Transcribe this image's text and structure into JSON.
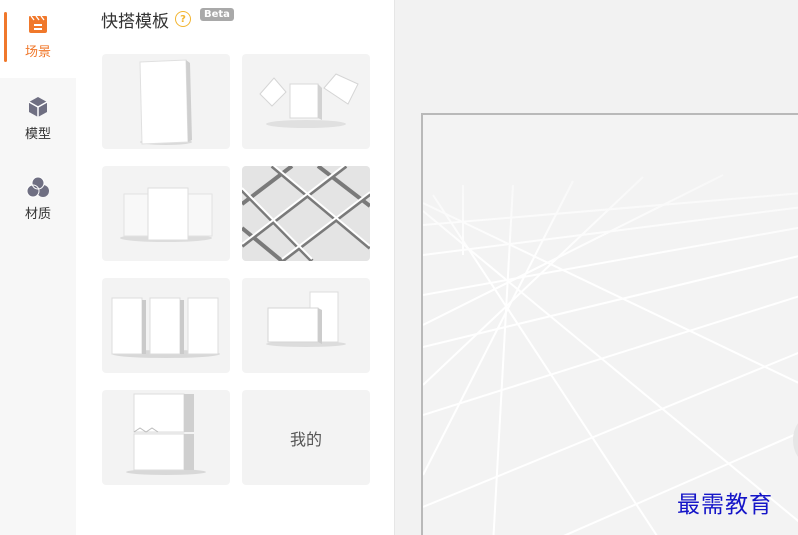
{
  "rail": {
    "items": [
      {
        "label": "场景",
        "icon": "scene-icon",
        "active": true
      },
      {
        "label": "模型",
        "icon": "cube-icon",
        "active": false
      },
      {
        "label": "材质",
        "icon": "material-icon",
        "active": false
      }
    ]
  },
  "panel": {
    "title": "快搭模板",
    "help_icon_text": "?",
    "badge": "Beta",
    "cards": [
      {
        "name": "template-single-board"
      },
      {
        "name": "template-floating-cubes"
      },
      {
        "name": "template-triple-panels"
      },
      {
        "name": "template-grid-floor"
      },
      {
        "name": "template-three-pillars"
      },
      {
        "name": "template-stacked-boxes"
      },
      {
        "name": "template-split-pillar"
      },
      {
        "name": "template-mine",
        "label": "我的"
      }
    ]
  },
  "watermark": "最需教育",
  "colors": {
    "accent": "#f0782b",
    "help": "#f2b531",
    "badge": "#a9a9a9",
    "watermark": "#1515c8"
  }
}
